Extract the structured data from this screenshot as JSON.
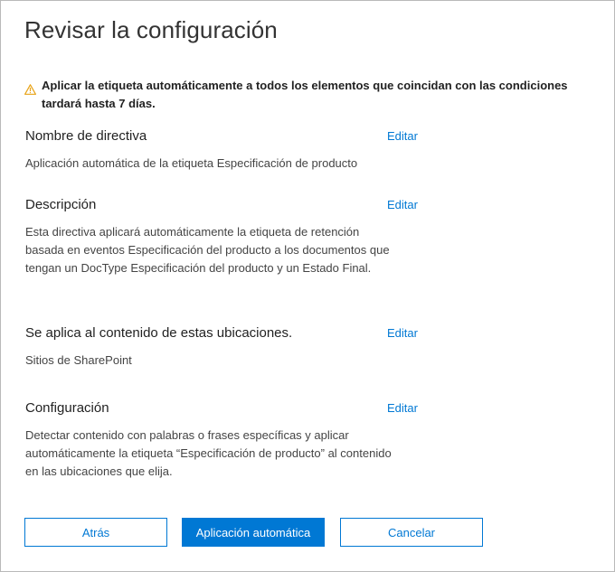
{
  "dialog": {
    "title": "Revisar la configuración"
  },
  "warning": {
    "icon": "warning-triangle-icon",
    "text": "Aplicar la etiqueta automáticamente a todos los elementos que coincidan con las condiciones tardará hasta 7 días."
  },
  "sections": [
    {
      "heading": "Nombre de directiva",
      "edit_label": "Editar",
      "body": "Aplicación automática de la etiqueta Especificación de producto"
    },
    {
      "heading": "Descripción",
      "edit_label": "Editar",
      "body": "Esta directiva aplicará automáticamente la etiqueta de retención basada en eventos Especificación del producto a los documentos que tengan un DocType Especificación del producto y un Estado Final."
    },
    {
      "heading": "Se aplica al contenido de estas ubicaciones.",
      "edit_label": "Editar",
      "body": "Sitios de SharePoint"
    },
    {
      "heading": "Configuración",
      "edit_label": "Editar",
      "body": "Detectar contenido con palabras o frases específicas y aplicar automáticamente la etiqueta “Especificación de producto” al contenido en las ubicaciones que elija."
    }
  ],
  "buttons": {
    "back_label": "Atrás",
    "auto_apply_label": "Aplicación automática",
    "cancel_label": "Cancelar"
  },
  "colors": {
    "accent": "#0078d4",
    "warning": "#e8a317",
    "border": "#b9b9b9"
  }
}
